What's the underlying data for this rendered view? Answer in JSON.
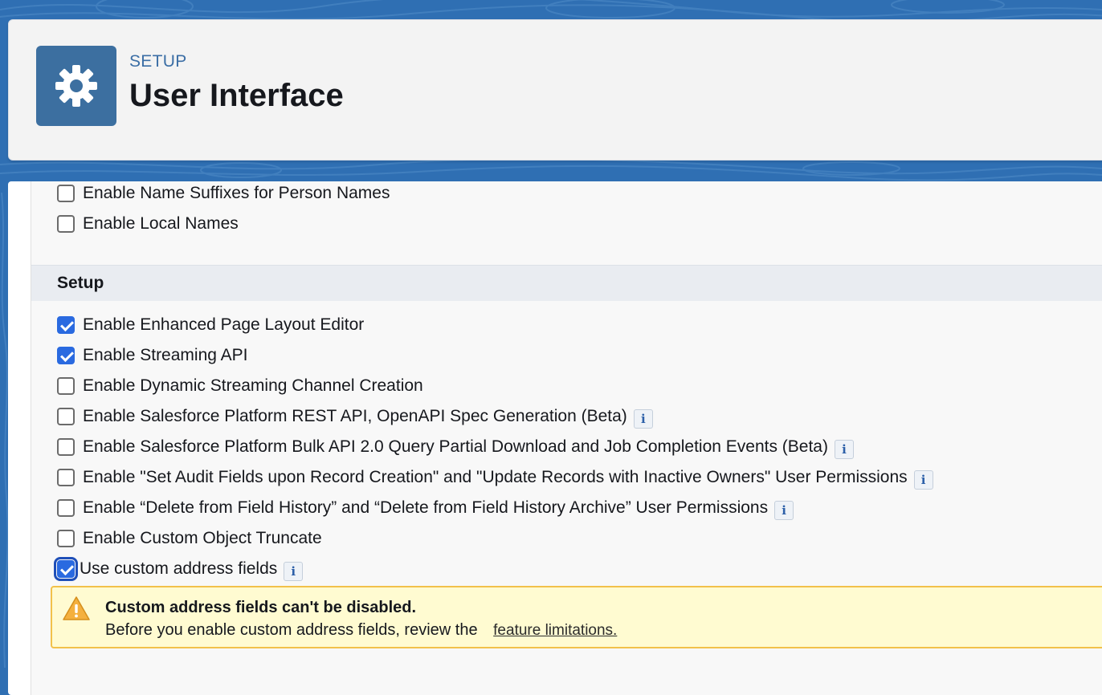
{
  "header": {
    "eyebrow": "SETUP",
    "title": "User Interface",
    "icon": "gear-icon",
    "icon_bg": "#3c6fa0"
  },
  "top_options": [
    {
      "label": "Enable Name Suffixes for Person Names",
      "checked": false
    },
    {
      "label": "Enable Local Names",
      "checked": false
    }
  ],
  "section": {
    "title": "Setup",
    "options": [
      {
        "label": "Enable Enhanced Page Layout Editor",
        "checked": true,
        "info": false
      },
      {
        "label": "Enable Streaming API",
        "checked": true,
        "info": false
      },
      {
        "label": "Enable Dynamic Streaming Channel Creation",
        "checked": false,
        "info": false
      },
      {
        "label": "Enable Salesforce Platform REST API, OpenAPI Spec Generation (Beta)",
        "checked": false,
        "info": true
      },
      {
        "label": "Enable Salesforce Platform Bulk API 2.0 Query Partial Download and Job Completion Events (Beta)",
        "checked": false,
        "info": true
      },
      {
        "label": "Enable \"Set Audit Fields upon Record Creation\" and \"Update Records with Inactive Owners\" User Permissions",
        "checked": false,
        "info": true
      },
      {
        "label": "Enable “Delete from Field History” and “Delete from Field History Archive” User Permissions",
        "checked": false,
        "info": true
      },
      {
        "label": "Enable Custom Object Truncate",
        "checked": false,
        "info": false
      },
      {
        "label": "Use custom address fields",
        "checked": true,
        "info": true,
        "focused": true
      }
    ]
  },
  "info_icon_text": "i",
  "warning": {
    "icon": "warning-icon",
    "title": "Custom address fields can't be disabled.",
    "text": "Before you enable custom address fields, review the",
    "link": "feature limitations."
  },
  "colors": {
    "accent": "#2a6ae0",
    "warning_bg": "#fffbd1",
    "warning_border": "#f2c14a"
  }
}
